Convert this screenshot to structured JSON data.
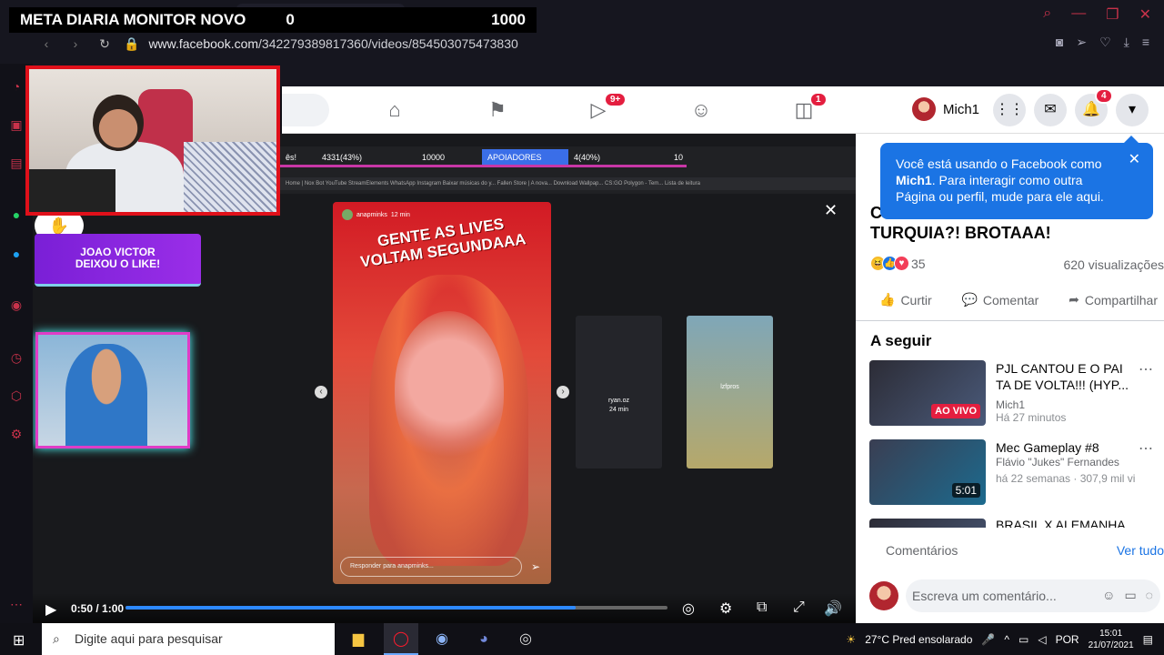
{
  "stream_goal": {
    "title": "META DIARIA MONITOR NOVO",
    "current": "0",
    "target": "1000"
  },
  "browser": {
    "url_host": "www.facebook.com",
    "url_path": "/342279389817360/videos/854503075473830",
    "accent_color": "#c8324a"
  },
  "facebook_nav": {
    "watch_badge": "9+",
    "gaming_badge": "1",
    "profile_name": "Mich1",
    "notifications_badge": "4"
  },
  "tooltip": {
    "text_before": "Você está usando o Facebook como ",
    "name": "Mich1",
    "text_after": ". Para interagir como outra Página ou perfil, mude para ele aqui."
  },
  "video": {
    "title_prefix": "C",
    "title_rest": "TURQUIA?! BROTAAA!",
    "reactions_count": "35",
    "views": "620 visualizações",
    "time": "0:50 / 1:00",
    "progress_fraction": 0.83
  },
  "actions": {
    "like": "Curtir",
    "comment": "Comentar",
    "share": "Compartilhar"
  },
  "inner_stream": {
    "overlay_a": "ês!",
    "overlay_b": "4331(43%)",
    "overlay_c": "10000",
    "overlay_d": "APOIADORES",
    "overlay_e": "4(40%)",
    "overlay_f": "10",
    "bookmarks": "Home | Nox Bot   YouTube   StreamElements   WhatsApp   Instagram   Baixar músicas do y...   Fallen Store | A nova...   Download Wallpap...   CS:GO Polygon - Tem...   Lista de leitura",
    "like_badge_line1": "JOAO VICTOR",
    "like_badge_line2": "DEIXOU O LIKE!",
    "story_author": "anapminks",
    "story_time": "12 min",
    "story_caption": "GENTE AS LIVES VOLTAM SEGUNDAAA",
    "story_reply_placeholder": "Responder para anapminks...",
    "side_story_1_user": "ryan.oz",
    "side_story_1_time": "24 min",
    "side_story_2_user": "lzfpros"
  },
  "up_next": {
    "heading": "A seguir",
    "items": [
      {
        "title": "PJL CANTOU E O PAI TA DE VOLTA!!! (HYP...",
        "channel": "Mich1",
        "meta": "Há 27 minutos",
        "badge": "AO VIVO"
      },
      {
        "title": "Mec Gameplay #8",
        "channel": "Flávio \"Jukes\" Fernandes",
        "meta": "há 22 semanas · 307,9 mil vi",
        "badge": "5:01"
      },
      {
        "title": "BRASIL X ALEMANHA",
        "channel": "",
        "meta": "",
        "badge": ""
      }
    ]
  },
  "comments": {
    "label": "Comentários",
    "see_all": "Ver tudo",
    "placeholder": "Escreva um comentário..."
  },
  "taskbar": {
    "search_placeholder": "Digite aqui para pesquisar",
    "weather": "27°C  Pred ensolarado",
    "lang": "POR",
    "time": "15:01",
    "date": "21/07/2021"
  }
}
